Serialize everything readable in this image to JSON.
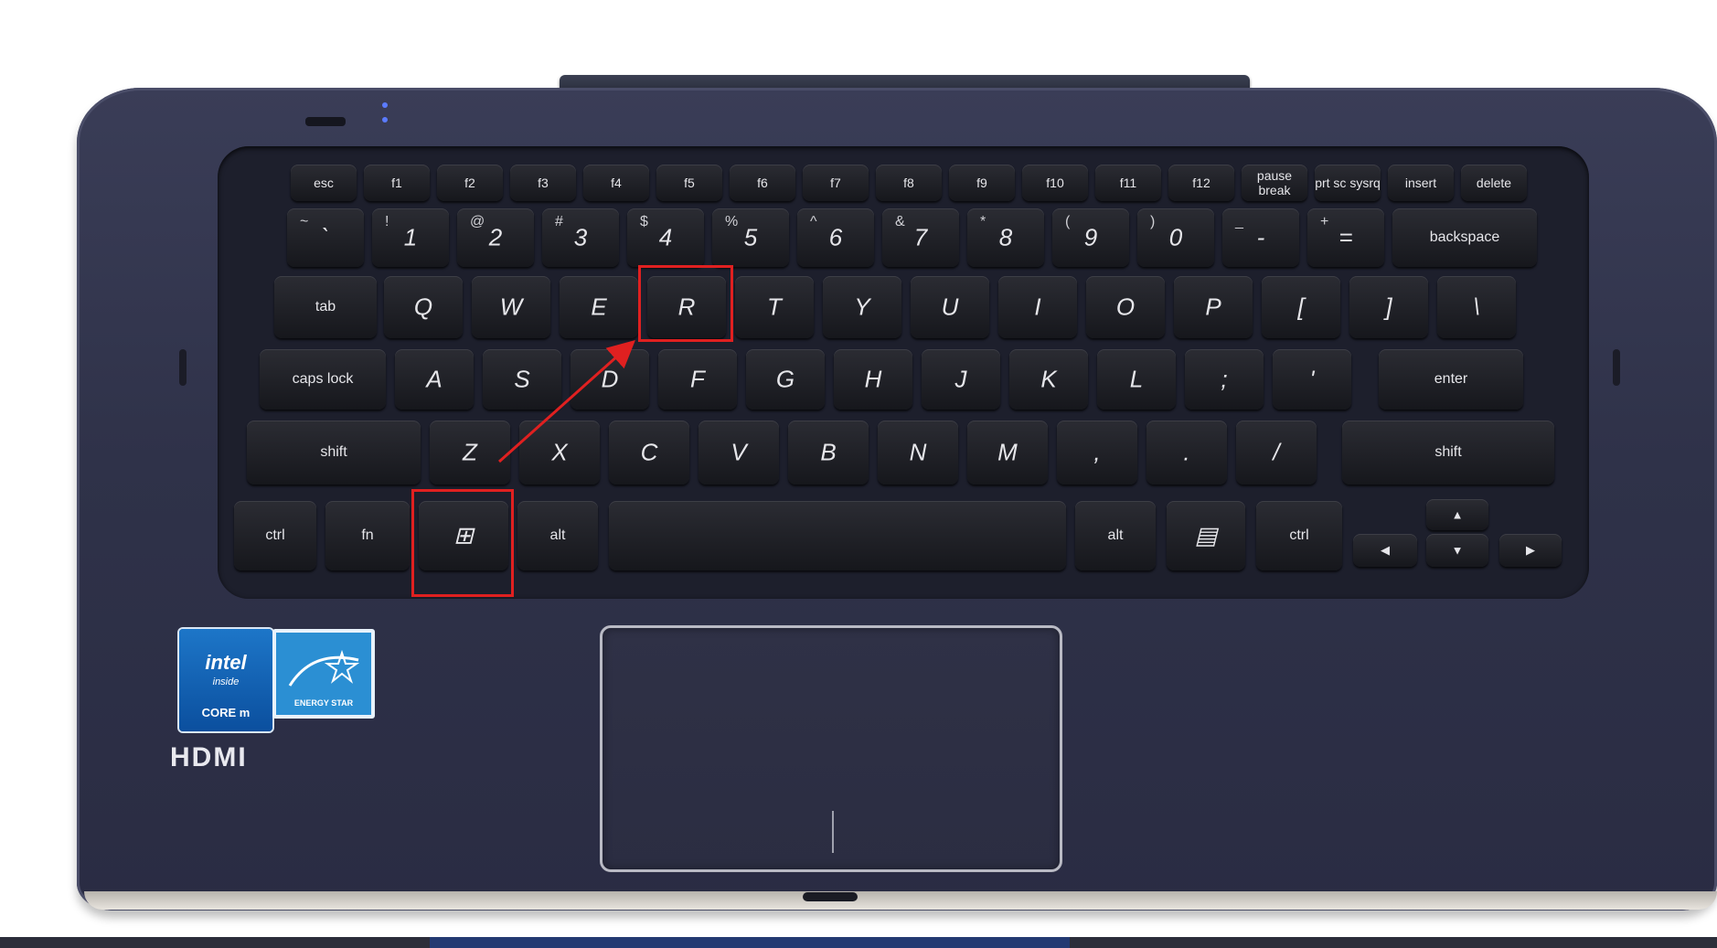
{
  "keyboard": {
    "row_fn": [
      "esc",
      "f1",
      "f2",
      "f3",
      "f4",
      "f5",
      "f6",
      "f7",
      "f8",
      "f9",
      "f10",
      "f11",
      "f12",
      "pause break",
      "prt sc sysrq",
      "insert",
      "delete"
    ],
    "row_num": [
      {
        "main": "`",
        "sub": "~"
      },
      {
        "main": "1",
        "sub": "!"
      },
      {
        "main": "2",
        "sub": "@"
      },
      {
        "main": "3",
        "sub": "#"
      },
      {
        "main": "4",
        "sub": "$"
      },
      {
        "main": "5",
        "sub": "%"
      },
      {
        "main": "6",
        "sub": "^"
      },
      {
        "main": "7",
        "sub": "&"
      },
      {
        "main": "8",
        "sub": "*"
      },
      {
        "main": "9",
        "sub": "("
      },
      {
        "main": "0",
        "sub": ")"
      },
      {
        "main": "-",
        "sub": "_"
      },
      {
        "main": "=",
        "sub": "+"
      },
      {
        "main": "backspace",
        "sub": ""
      }
    ],
    "row_q": [
      "tab",
      "Q",
      "W",
      "E",
      "R",
      "T",
      "Y",
      "U",
      "I",
      "O",
      "P",
      "[",
      "]",
      "\\"
    ],
    "row_a": [
      "caps lock",
      "A",
      "S",
      "D",
      "F",
      "G",
      "H",
      "J",
      "K",
      "L",
      ";",
      "'",
      "enter"
    ],
    "row_z": [
      "shift",
      "Z",
      "X",
      "C",
      "V",
      "B",
      "N",
      "M",
      ",",
      ".",
      "/",
      "shift"
    ],
    "row_bottom": [
      "ctrl",
      "fn",
      "windows",
      "alt",
      "",
      "alt",
      "menu",
      "ctrl"
    ],
    "arrows": [
      "up",
      "left",
      "down",
      "right"
    ],
    "arrow_glyphs": {
      "up": "▲",
      "left": "◀",
      "down": "▼",
      "right": "▶"
    },
    "windows_glyph": "⊞",
    "menu_glyph": "▤"
  },
  "stickers": {
    "intel": {
      "line1": "intel",
      "line2": "inside",
      "line3": "CORE m"
    },
    "energy_star": {
      "text": "ENERGY STAR"
    },
    "hdmi": {
      "text": "HDMI"
    }
  },
  "annotation": {
    "highlighted_keys": [
      "windows",
      "R"
    ],
    "color": "#e02020"
  }
}
